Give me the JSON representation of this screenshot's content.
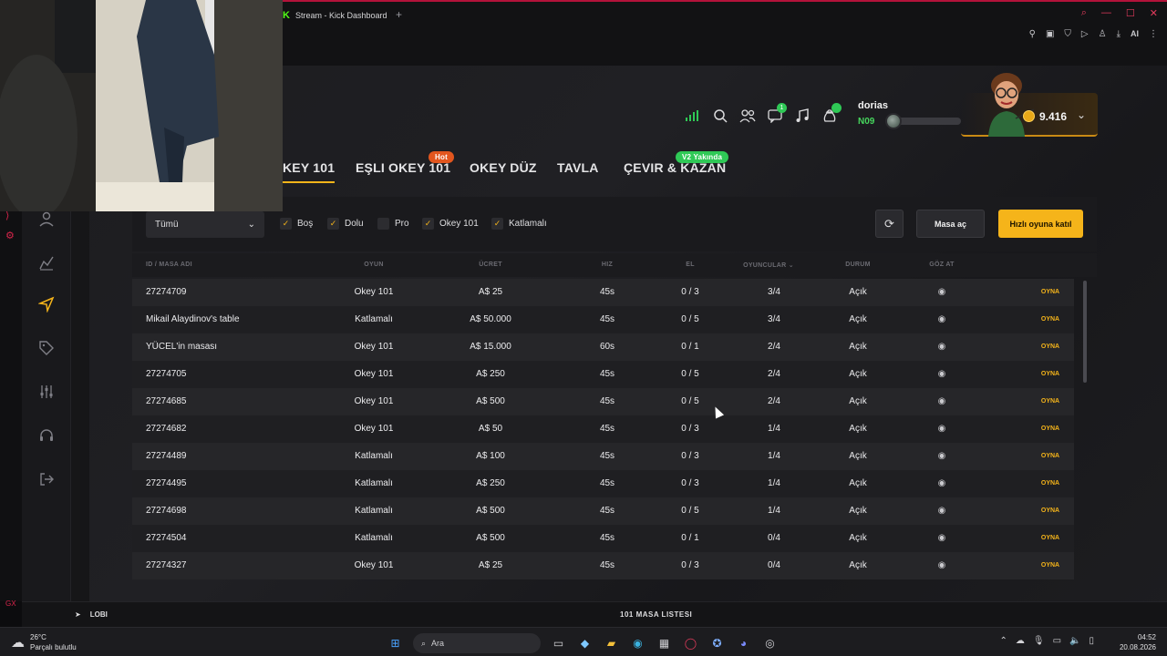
{
  "browser": {
    "tab_title": "Stream - Kick Dashboard",
    "tab_logo": "K",
    "ai_label": "AI"
  },
  "header": {
    "username": "dorias",
    "level": "N09",
    "xp_fraction": 0,
    "coins": "9.416",
    "chat_badge": "1"
  },
  "game_tabs": [
    {
      "label": "KEY 101",
      "active": true,
      "badge": ""
    },
    {
      "label": "EŞLI OKEY 101",
      "active": false,
      "badge": "Hot"
    },
    {
      "label": "OKEY DÜZ",
      "active": false,
      "badge": ""
    },
    {
      "label": "TAVLA",
      "active": false,
      "badge": ""
    },
    {
      "label": "ÇEVIR & KAZAN",
      "active": false,
      "badge": "V2 Yakında"
    }
  ],
  "filters": {
    "select_value": "Tümü",
    "checkboxes": [
      {
        "label": "Boş",
        "checked": true
      },
      {
        "label": "Dolu",
        "checked": true
      },
      {
        "label": "Pro",
        "checked": false
      },
      {
        "label": "Okey 101",
        "checked": true
      },
      {
        "label": "Katlamalı",
        "checked": true
      }
    ],
    "create_table": "Masa aç",
    "quick_join": "Hızlı oyuna katıl"
  },
  "table": {
    "headers": [
      "ID / MASA ADI",
      "OYUN",
      "ÜCRET",
      "HIZ",
      "EL",
      "OYUNCULAR",
      "DURUM",
      "GÖZ AT"
    ],
    "play_label": "OYNA",
    "rows": [
      {
        "id": "27274709",
        "game": "Okey 101",
        "fee": "A$  25",
        "speed": "45s",
        "hand": "0 / 3",
        "players": "3/4",
        "status": "Açık"
      },
      {
        "id": "Mikail Alaydinov's table",
        "game": "Katlamalı",
        "fee": "A$  50.000",
        "speed": "45s",
        "hand": "0 / 5",
        "players": "3/4",
        "status": "Açık"
      },
      {
        "id": "YÜCEL'in masası",
        "game": "Okey 101",
        "fee": "A$  15.000",
        "speed": "60s",
        "hand": "0 / 1",
        "players": "2/4",
        "status": "Açık"
      },
      {
        "id": "27274705",
        "game": "Okey 101",
        "fee": "A$  250",
        "speed": "45s",
        "hand": "0 / 5",
        "players": "2/4",
        "status": "Açık"
      },
      {
        "id": "27274685",
        "game": "Okey 101",
        "fee": "A$  500",
        "speed": "45s",
        "hand": "0 / 5",
        "players": "2/4",
        "status": "Açık"
      },
      {
        "id": "27274682",
        "game": "Okey 101",
        "fee": "A$  50",
        "speed": "45s",
        "hand": "0 / 3",
        "players": "1/4",
        "status": "Açık"
      },
      {
        "id": "27274489",
        "game": "Katlamalı",
        "fee": "A$  100",
        "speed": "45s",
        "hand": "0 / 3",
        "players": "1/4",
        "status": "Açık"
      },
      {
        "id": "27274495",
        "game": "Katlamalı",
        "fee": "A$  250",
        "speed": "45s",
        "hand": "0 / 3",
        "players": "1/4",
        "status": "Açık"
      },
      {
        "id": "27274698",
        "game": "Katlamalı",
        "fee": "A$  500",
        "speed": "45s",
        "hand": "0 / 5",
        "players": "1/4",
        "status": "Açık"
      },
      {
        "id": "27274504",
        "game": "Katlamalı",
        "fee": "A$  500",
        "speed": "45s",
        "hand": "0 / 1",
        "players": "0/4",
        "status": "Açık"
      },
      {
        "id": "27274327",
        "game": "Okey 101",
        "fee": "A$  25",
        "speed": "45s",
        "hand": "0 / 3",
        "players": "0/4",
        "status": "Açık"
      }
    ]
  },
  "bottom": {
    "lobby": "LOBI",
    "table_list": "101 MASA LISTESI"
  },
  "taskbar": {
    "temperature": "26°C",
    "weather": "Parçalı bulutlu",
    "search": "Ara",
    "time": "04:52",
    "date": "20.08.2026"
  },
  "colors": {
    "accent": "#f5b41a",
    "success": "#2fc956",
    "hot": "#e2561e",
    "browser_accent": "#b3123a"
  }
}
